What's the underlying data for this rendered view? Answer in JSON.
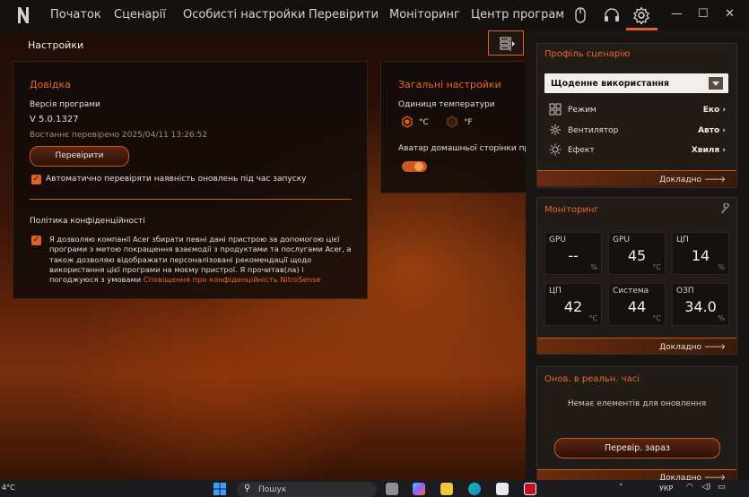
{
  "nav": {
    "tabs": [
      "Початок",
      "Сценарії",
      "Особисті настройки",
      "Перевірити",
      "Моніторинг",
      "Центр програм"
    ]
  },
  "page": {
    "title": "Настройки"
  },
  "help": {
    "title": "Довідка",
    "version_label": "Версія програми",
    "version_value": "V 5.0.1327",
    "last_checked": "Востаннє перевірено 2025/04/11 13:26:52",
    "check_button": "Перевірити",
    "auto_update_label": "Автоматично перевіряти наявність оновлень під час запуску",
    "auto_update_checked": true,
    "privacy_title": "Політика конфіденційності",
    "privacy_text": "Я дозволяю компанії Acer збирати певні дані пристрою за допомогою цієї програми з метою покращення взаємодії з продуктами та послугами Acer, а також дозволяю відображати персоналізовані рекомендації щодо використання цієї програми на моєму пристрої. Я прочитав(ла) і погоджуюся з умовами",
    "privacy_link": "Сповіщення про конфіденційність NitroSense",
    "privacy_checked": true
  },
  "general": {
    "title": "Загальні настройки",
    "temp_unit_label": "Одиниця температури",
    "unit_c": "°C",
    "unit_f": "°F",
    "selected_unit": "°C",
    "avatar_label": "Аватар домашньої сторінки пре",
    "avatar_toggle_on": true
  },
  "profile": {
    "title": "Профіль сценарію",
    "selected": "Щоденне використання",
    "rows": [
      {
        "label": "Режим",
        "value": "Еко",
        "icon": "mode-grid-icon"
      },
      {
        "label": "Вентилятор",
        "value": "Авто",
        "icon": "fan-icon"
      },
      {
        "label": "Ефект",
        "value": "Хвиля",
        "icon": "light-effect-icon"
      }
    ],
    "more": "Докладно"
  },
  "monitoring": {
    "title": "Моніторинг",
    "tiles": [
      {
        "label": "GPU",
        "value": "--",
        "unit": "%"
      },
      {
        "label": "GPU",
        "value": "45",
        "unit": "°C"
      },
      {
        "label": "ЦП",
        "value": "14",
        "unit": "%"
      },
      {
        "label": "ЦП",
        "value": "42",
        "unit": "°C"
      },
      {
        "label": "Система",
        "value": "44",
        "unit": "°C"
      },
      {
        "label": "ОЗП",
        "value": "34.0",
        "unit": "%"
      }
    ],
    "more": "Докладно"
  },
  "updates": {
    "title": "Онов. в реальн. часі",
    "empty": "Немає елементів для оновлення",
    "button": "Перевір. зараз",
    "more": "Докладно"
  },
  "taskbar": {
    "temp": "4°C",
    "search": "Пошук",
    "lang": "УКР"
  },
  "colors": {
    "accent": "#e0612a",
    "panel": "#120c0a",
    "text": "#e8e2de"
  }
}
